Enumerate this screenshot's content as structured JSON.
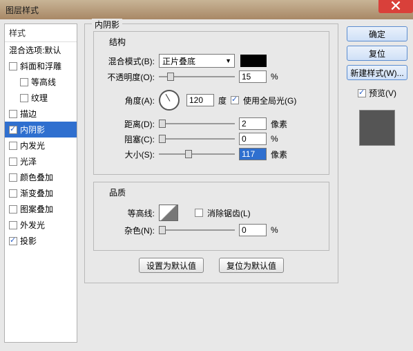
{
  "title": "图层样式",
  "sidebar_header": "样式",
  "sidebar": [
    {
      "label": "混合选项:默认",
      "type": "plain"
    },
    {
      "label": "斜面和浮雕",
      "type": "chk",
      "checked": false
    },
    {
      "label": "等高线",
      "type": "chk",
      "checked": false,
      "sub": true
    },
    {
      "label": "纹理",
      "type": "chk",
      "checked": false,
      "sub": true
    },
    {
      "label": "描边",
      "type": "chk",
      "checked": false
    },
    {
      "label": "内阴影",
      "type": "chk",
      "checked": true,
      "selected": true
    },
    {
      "label": "内发光",
      "type": "chk",
      "checked": false
    },
    {
      "label": "光泽",
      "type": "chk",
      "checked": false
    },
    {
      "label": "颜色叠加",
      "type": "chk",
      "checked": false
    },
    {
      "label": "渐变叠加",
      "type": "chk",
      "checked": false
    },
    {
      "label": "图案叠加",
      "type": "chk",
      "checked": false
    },
    {
      "label": "外发光",
      "type": "chk",
      "checked": false
    },
    {
      "label": "投影",
      "type": "chk",
      "checked": true
    }
  ],
  "panel_title": "内阴影",
  "group_structure": "结构",
  "blend_mode_label": "混合模式(B):",
  "blend_mode_value": "正片叠底",
  "opacity_label": "不透明度(O):",
  "opacity_value": "15",
  "percent": "%",
  "angle_label": "角度(A):",
  "angle_value": "120",
  "angle_unit": "度",
  "global_light": "使用全局光(G)",
  "distance_label": "距离(D):",
  "distance_value": "2",
  "choke_label": "阻塞(C):",
  "choke_value": "0",
  "size_label": "大小(S):",
  "size_value": "117",
  "px": "像素",
  "group_quality": "品质",
  "contour_label": "等高线:",
  "antialias": "消除锯齿(L)",
  "noise_label": "杂色(N):",
  "noise_value": "0",
  "btn_default": "设置为默认值",
  "btn_reset": "复位为默认值",
  "btn_ok": "确定",
  "btn_cancel": "复位",
  "btn_newstyle": "新建样式(W)...",
  "preview_label": "预览(V)"
}
